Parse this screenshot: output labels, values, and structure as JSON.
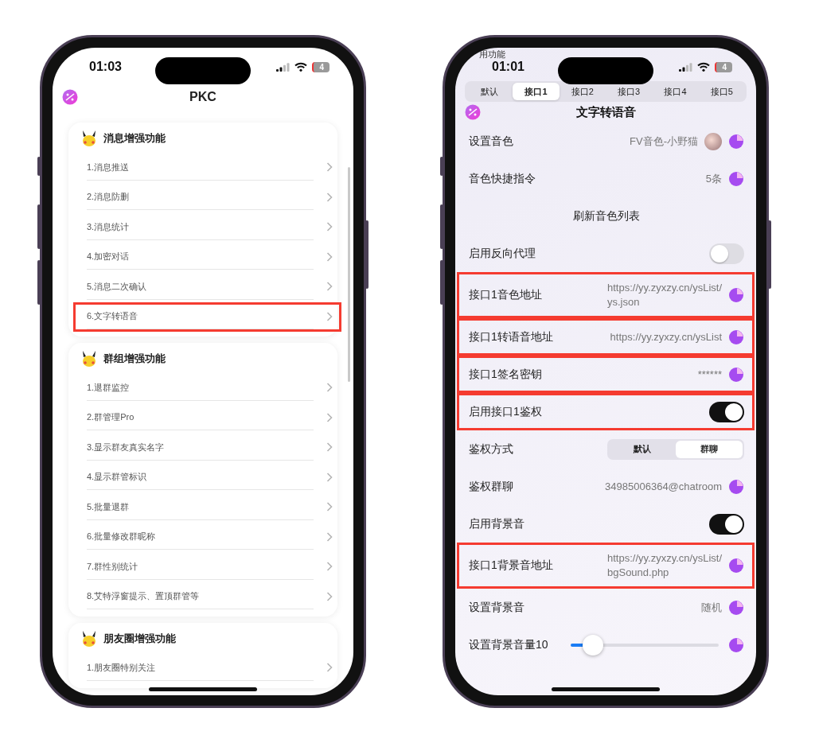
{
  "phones": [
    {
      "kind": "menu",
      "status": {
        "time": "01:03",
        "battery": "4"
      },
      "title": "PKC",
      "sections": [
        {
          "title": "消息增强功能",
          "items": [
            {
              "label": "1.消息推送",
              "highlighted": false
            },
            {
              "label": "2.消息防删",
              "highlighted": false
            },
            {
              "label": "3.消息统计",
              "highlighted": false
            },
            {
              "label": "4.加密对话",
              "highlighted": false
            },
            {
              "label": "5.消息二次确认",
              "highlighted": false
            },
            {
              "label": "6.文字转语音",
              "highlighted": true
            }
          ]
        },
        {
          "title": "群组增强功能",
          "items": [
            {
              "label": "1.退群监控",
              "highlighted": false
            },
            {
              "label": "2.群管理Pro",
              "highlighted": false
            },
            {
              "label": "3.显示群友真实名字",
              "highlighted": false
            },
            {
              "label": "4.显示群管标识",
              "highlighted": false
            },
            {
              "label": "5.批量退群",
              "highlighted": false
            },
            {
              "label": "6.批量修改群昵称",
              "highlighted": false
            },
            {
              "label": "7.群性别统计",
              "highlighted": false
            },
            {
              "label": "8.艾特浮窗提示、置顶群管等",
              "highlighted": false
            }
          ]
        },
        {
          "title": "朋友圈增强功能",
          "items": [
            {
              "label": "1.朋友圈特别关注",
              "highlighted": false
            }
          ]
        }
      ]
    },
    {
      "kind": "settings",
      "status": {
        "time": "01:01",
        "battery": "4"
      },
      "corner_text": "用功能",
      "tabs": [
        {
          "label": "默认",
          "selected": false
        },
        {
          "label": "接口1",
          "selected": true
        },
        {
          "label": "接口2",
          "selected": false
        },
        {
          "label": "接口3",
          "selected": false
        },
        {
          "label": "接口4",
          "selected": false
        },
        {
          "label": "接口5",
          "selected": false
        }
      ],
      "title": "文字转语音",
      "rows": [
        {
          "kind": "value",
          "label": "设置音色",
          "value": "FV音色-小野猫",
          "avatar": true,
          "highlighted": false
        },
        {
          "kind": "value",
          "label": "音色快捷指令",
          "value": "5条",
          "highlighted": false
        },
        {
          "kind": "button",
          "label": "刷新音色列表",
          "highlighted": false
        },
        {
          "kind": "toggle",
          "label": "启用反向代理",
          "on": false,
          "highlighted": false
        },
        {
          "kind": "value",
          "label": "接口1音色地址",
          "value": "https://yy.zyxzy.cn/ysList/\nys.json",
          "highlighted": true
        },
        {
          "kind": "value",
          "label": "接口1转语音地址",
          "value": "https://yy.zyxzy.cn/ysList",
          "highlighted": true
        },
        {
          "kind": "value",
          "label": "接口1签名密钥",
          "value": "******",
          "highlighted": true
        },
        {
          "kind": "toggle",
          "label": "启用接口1鉴权",
          "on": true,
          "highlighted": true
        },
        {
          "kind": "segmented",
          "label": "鉴权方式",
          "options": [
            {
              "label": "默认",
              "selected": false
            },
            {
              "label": "群聊",
              "selected": true
            }
          ],
          "highlighted": false
        },
        {
          "kind": "value",
          "label": "鉴权群聊",
          "value": "34985006364@chatroom",
          "highlighted": false
        },
        {
          "kind": "toggle",
          "label": "启用背景音",
          "on": true,
          "highlighted": false
        },
        {
          "kind": "value",
          "label": "接口1背景音地址",
          "value": "https://yy.zyxzy.cn/ysList/\nbgSound.php",
          "highlighted": true
        },
        {
          "kind": "value",
          "label": "设置背景音",
          "value": "随机",
          "highlighted": false
        },
        {
          "kind": "slider",
          "label": "设置背景音量10",
          "level": 0.15,
          "highlighted": false
        }
      ]
    }
  ]
}
